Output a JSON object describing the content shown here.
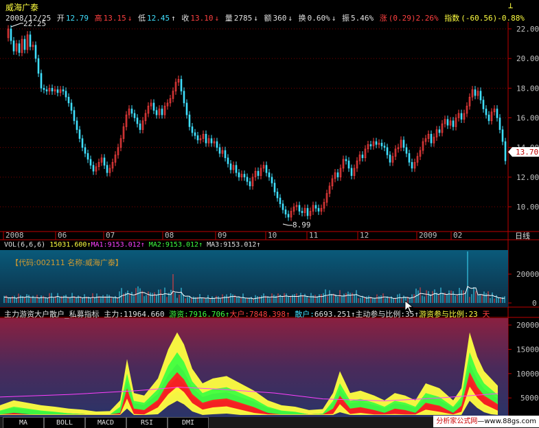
{
  "header": {
    "stock_name": "威海广泰",
    "date": "2008/12/25",
    "open_label": "开",
    "open": "12.79",
    "high_label": "高",
    "high": "13.15",
    "low_label": "低",
    "low": "12.45",
    "close_label": "收",
    "close": "13.10",
    "volume_label": "量",
    "volume": "2785",
    "amount_label": "额",
    "amount": "360",
    "turnover_label": "换",
    "turnover": "0.60%",
    "amplitude_label": "振",
    "amplitude": "5.46%",
    "change_label": "涨",
    "change": "(0.29)2.26%",
    "index_label": "指数",
    "index": "(-60.56)-0.88%"
  },
  "price_chart": {
    "y_ticks": [
      "22.00",
      "20.00",
      "18.00",
      "16.00",
      "14.00",
      "12.00",
      "10.00"
    ],
    "current_price": "13.70",
    "max_label": "22.25",
    "min_label": "8.99",
    "x_labels": [
      "2008",
      "06",
      "07",
      "08",
      "09",
      "10",
      "11",
      "12",
      "2009",
      "02"
    ],
    "period_label": "日线"
  },
  "volume_panel": {
    "label": "VOL(6,6,6)",
    "vol": "15031.600",
    "ma1_label": "MA1:",
    "ma1": "9153.012",
    "ma2_label": "MA2:",
    "ma2": "9153.012",
    "ma3_label": "MA3:",
    "ma3": "9153.012",
    "code_text": "【代码:002111 名称:威海广泰】",
    "y_ticks": [
      "20000",
      "0"
    ]
  },
  "indicator_panel": {
    "title": "主力游资大户散户_私募指标",
    "main_label": "主力:",
    "main": "11964.660",
    "hot_label": "游资:",
    "hot": "7916.706",
    "big_label": "大户:",
    "big": "7848.398",
    "retail_label": "散户:",
    "retail": "6693.251",
    "ratio_label": "主动参与比例:",
    "ratio": "35",
    "hot_ratio_label": "游资参与比例:",
    "hot_ratio": "23",
    "trail": "天",
    "y_ticks": [
      "20000",
      "15000",
      "10000",
      "5000"
    ]
  },
  "tabs": [
    "MA",
    "BOLL",
    "MACD",
    "RSI",
    "DMI"
  ],
  "watermark": {
    "site": "分析家公式网",
    "url": "www.88gs.com"
  },
  "colors": {
    "up": "#ff4040",
    "down": "#40e0ff",
    "axis": "#c00000"
  }
}
